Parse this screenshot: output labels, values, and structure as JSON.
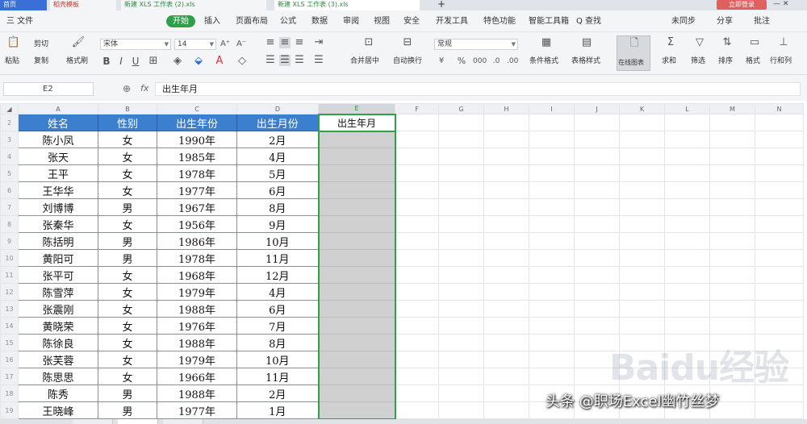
{
  "tabs": {
    "home": "首页",
    "template": "稻壳模板",
    "book1": "新建 XLS 工作表 (2).xls",
    "book2": "新建 XLS 工作表 (3).xls",
    "plus": "+"
  },
  "login": "立即登录",
  "menus": [
    "三 文件",
    "开始",
    "插入",
    "页面布局",
    "公式",
    "数据",
    "审阅",
    "视图",
    "安全",
    "开发工具",
    "特色功能",
    "智能工具箱",
    "Q 查找",
    "未同步",
    "分享",
    "批注"
  ],
  "toolbar": {
    "paste": "粘贴",
    "cut": "剪切",
    "copy": "复制",
    "format_painter": "格式刷",
    "font": "宋体",
    "size": "14",
    "bold": "B",
    "italic": "I",
    "underline": "U",
    "merge": "合并居中",
    "wrap": "自动换行",
    "numfmt": "常规",
    "cond_format": "条件格式",
    "table_style": "表格样式",
    "dialog": "在线图表",
    "sum": "求和",
    "filter": "筛选",
    "sort": "排序",
    "format": "格式",
    "rowcol": "行和列"
  },
  "formula": {
    "name_box": "E2",
    "fx": "fx",
    "value": "出生年月"
  },
  "columns": [
    "A",
    "B",
    "C",
    "D",
    "E",
    "F",
    "G",
    "H",
    "I",
    "J",
    "K",
    "L",
    "M",
    "N"
  ],
  "headers": {
    "name": "姓名",
    "gender": "性别",
    "year": "出生年份",
    "month": "出生月份",
    "result": "出生年月"
  },
  "rows": [
    {
      "name": "陈小凤",
      "gender": "女",
      "year": "1990年",
      "month": "2月"
    },
    {
      "name": "张天",
      "gender": "女",
      "year": "1985年",
      "month": "4月"
    },
    {
      "name": "王平",
      "gender": "女",
      "year": "1978年",
      "month": "5月"
    },
    {
      "name": "王华华",
      "gender": "女",
      "year": "1977年",
      "month": "6月"
    },
    {
      "name": "刘博博",
      "gender": "男",
      "year": "1967年",
      "month": "8月"
    },
    {
      "name": "张秦华",
      "gender": "女",
      "year": "1956年",
      "month": "9月"
    },
    {
      "name": "陈括明",
      "gender": "男",
      "year": "1986年",
      "month": "10月"
    },
    {
      "name": "黄阳可",
      "gender": "男",
      "year": "1978年",
      "month": "11月"
    },
    {
      "name": "张平可",
      "gender": "女",
      "year": "1968年",
      "month": "12月"
    },
    {
      "name": "陈雪萍",
      "gender": "女",
      "year": "1979年",
      "month": "4月"
    },
    {
      "name": "张震刚",
      "gender": "女",
      "year": "1988年",
      "month": "6月"
    },
    {
      "name": "黄晓荣",
      "gender": "女",
      "year": "1976年",
      "month": "7月"
    },
    {
      "name": "陈徐良",
      "gender": "女",
      "year": "1988年",
      "month": "8月"
    },
    {
      "name": "张芙蓉",
      "gender": "女",
      "year": "1979年",
      "month": "10月"
    },
    {
      "name": "陈思思",
      "gender": "女",
      "year": "1966年",
      "month": "11月"
    },
    {
      "name": "陈秀",
      "gender": "男",
      "year": "1988年",
      "month": "2月"
    },
    {
      "name": "王晓峰",
      "gender": "男",
      "year": "1977年",
      "month": "1月"
    }
  ],
  "row_numbers": [
    "2",
    "3",
    "4",
    "5",
    "6",
    "7",
    "8",
    "9",
    "10",
    "11",
    "12",
    "13",
    "14",
    "15",
    "16",
    "17",
    "18",
    "19"
  ],
  "watermark": {
    "logo": "Baidu经验",
    "credit": "头条 @职场Excel幽竹丝梦"
  }
}
